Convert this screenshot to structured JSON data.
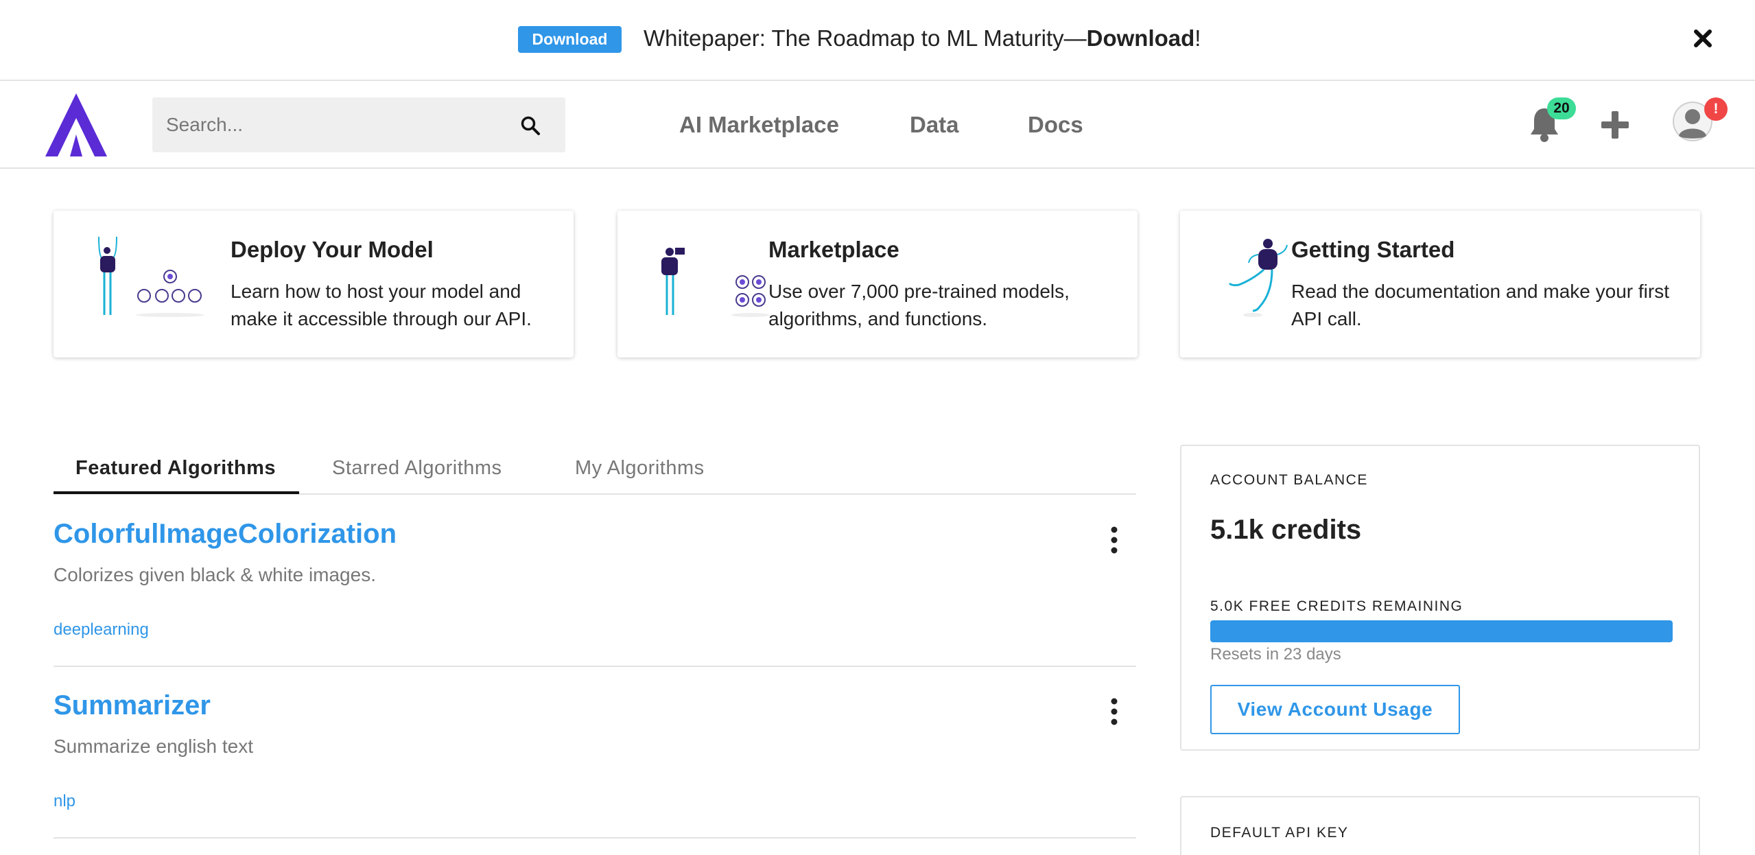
{
  "banner": {
    "button_label": "Download",
    "text_prefix": "Whitepaper: The Roadmap to ML Maturity—",
    "text_bold": "Download",
    "text_suffix": "!",
    "close_icon": "close-icon"
  },
  "nav": {
    "logo_icon": "logo-icon",
    "search_placeholder": "Search...",
    "links": [
      "AI Marketplace",
      "Data",
      "Docs"
    ],
    "notification_count": "20",
    "profile_alert": "!",
    "icons": [
      "bell-icon",
      "plus-icon",
      "user-avatar-icon"
    ]
  },
  "cards": [
    {
      "title": "Deploy Your Model",
      "description": "Learn how to host your model and make it accessible through our API."
    },
    {
      "title": "Marketplace",
      "description": "Use over 7,000 pre-trained models, algorithms, and functions."
    },
    {
      "title": "Getting Started",
      "description": "Read the documentation and make your first API call."
    }
  ],
  "tabs": {
    "items": [
      "Featured Algorithms",
      "Starred Algorithms",
      "My Algorithms"
    ],
    "active": "Featured Algorithms"
  },
  "algorithms": [
    {
      "name": "ColorfulImageColorization",
      "description": "Colorizes given black & white images.",
      "tag": "deeplearning"
    },
    {
      "name": "Summarizer",
      "description": "Summarize english text",
      "tag": "nlp"
    }
  ],
  "account": {
    "balance_heading": "ACCOUNT BALANCE",
    "balance": "5.1k credits",
    "free_credits_label": "5.0K FREE CREDITS REMAINING",
    "free_credits_fraction": 1.0,
    "resets_text": "Resets in 23 days",
    "usage_button": "View Account Usage",
    "api_key_heading": "DEFAULT API KEY"
  },
  "colors": {
    "accent": "#2f96e8",
    "logo": "#5b2bd6",
    "notification_badge": "#3ddc97",
    "alert_badge": "#f04646"
  }
}
